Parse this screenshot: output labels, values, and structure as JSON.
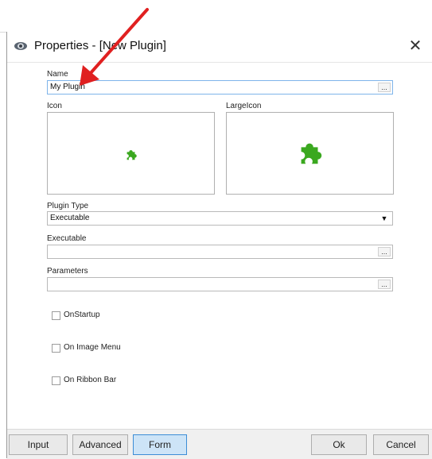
{
  "window": {
    "title": "Properties - [New Plugin]",
    "close_glyph": "✕",
    "icon": "app-eye-icon"
  },
  "form": {
    "name_label": "Name",
    "name_value": "My Plugin",
    "icon_label": "Icon",
    "large_icon_label": "LargeIcon",
    "plugin_type_label": "Plugin Type",
    "plugin_type_value": "Executable",
    "executable_label": "Executable",
    "executable_value": "",
    "parameters_label": "Parameters",
    "parameters_value": "",
    "ellipsis": "...",
    "dropdown_glyph": "▼",
    "puzzle_icon": "puzzle-piece-icon",
    "puzzle_color": "#3aa81f"
  },
  "checkboxes": [
    {
      "label": "OnStartup",
      "checked": false
    },
    {
      "label": "On Image Menu",
      "checked": false
    },
    {
      "label": "On Ribbon Bar",
      "checked": false
    }
  ],
  "buttons": {
    "input": "Input",
    "advanced": "Advanced",
    "form": "Form",
    "ok": "Ok",
    "cancel": "Cancel"
  },
  "annotation": {
    "arrow_color": "#e02020"
  }
}
